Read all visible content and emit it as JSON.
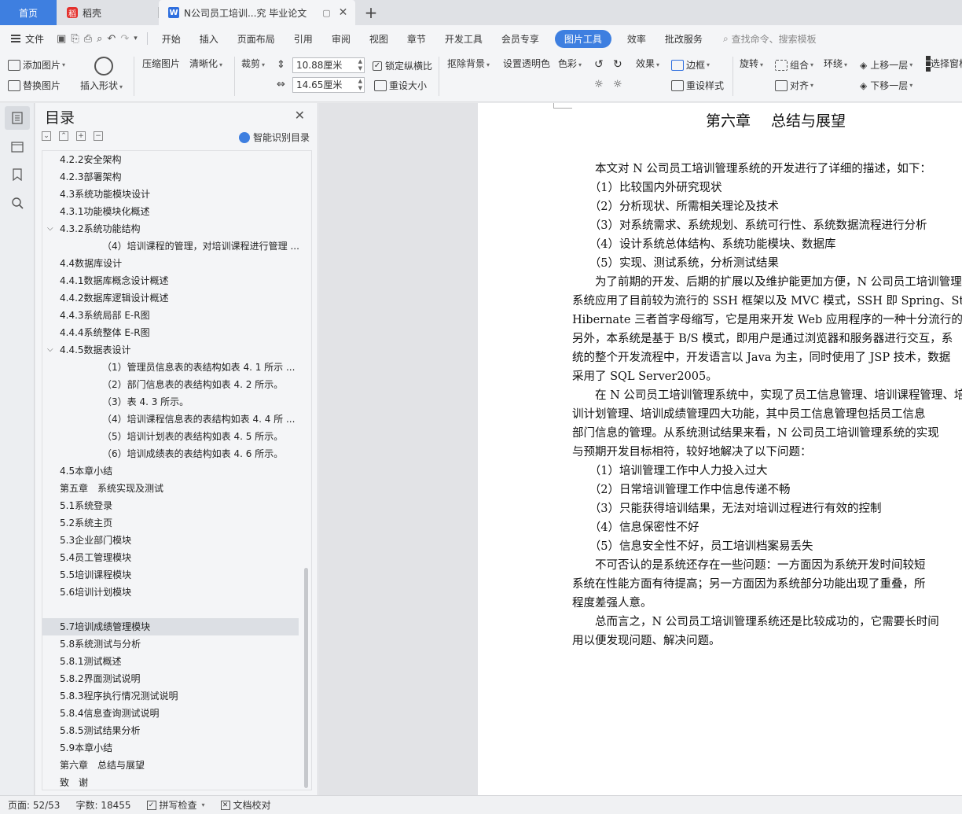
{
  "tabs": {
    "home": "首页",
    "dk": "稻壳",
    "doc": "N公司员工培训...究 毕业论文"
  },
  "menu": {
    "file": "文件",
    "items": [
      "开始",
      "插入",
      "页面布局",
      "引用",
      "审阅",
      "视图",
      "章节",
      "开发工具",
      "会员专享"
    ],
    "active": "图片工具",
    "after": [
      "效率",
      "批改服务"
    ],
    "search": "查找命令、搜索模板"
  },
  "ribbon": {
    "add_image": "添加图片",
    "replace_image": "替换图片",
    "insert_shape": "插入形状",
    "compress": "压缩图片",
    "sharpen": "清晰化",
    "crop": "裁剪",
    "height": "10.88厘米",
    "width": "14.65厘米",
    "lock_ratio": "锁定纵横比",
    "reset_size": "重设大小",
    "remove_bg": "抠除背景",
    "set_transparent": "设置透明色",
    "color": "色彩",
    "effects": "效果",
    "border": "边框",
    "reset_style": "重设样式",
    "rotate": "旋转",
    "group": "组合",
    "align": "对齐",
    "wrap": "环绕",
    "bring_forward": "上移一层",
    "send_backward": "下移一层",
    "select_pane": "选择窗格"
  },
  "toc": {
    "title": "目录",
    "smart": "智能识别目录",
    "items": [
      {
        "text": "4.2.2安全架构",
        "level": 1
      },
      {
        "text": "4.2.3部署架构",
        "level": 1
      },
      {
        "text": "4.3系统功能模块设计",
        "level": 1
      },
      {
        "text": "4.3.1功能模块化概述",
        "level": 1
      },
      {
        "text": "4.3.2系统功能结构",
        "level": 1,
        "expanded": true
      },
      {
        "text": "（4）培训课程的管理，对培训课程进行管理 ...",
        "level": 2
      },
      {
        "text": "4.4数据库设计",
        "level": 1
      },
      {
        "text": "4.4.1数据库概念设计概述",
        "level": 1
      },
      {
        "text": "4.4.2数据库逻辑设计概述",
        "level": 1
      },
      {
        "text": "4.4.3系统局部 E-R图",
        "level": 1
      },
      {
        "text": "4.4.4系统整体 E-R图",
        "level": 1
      },
      {
        "text": "4.4.5数据表设计",
        "level": 1,
        "expanded": true
      },
      {
        "text": "（1）管理员信息表的表结构如表 4. 1 所示 ...",
        "level": 2
      },
      {
        "text": "（2）部门信息表的表结构如表 4. 2 所示。",
        "level": 2
      },
      {
        "text": "（3）表 4. 3 所示。",
        "level": 2
      },
      {
        "text": "（4）培训课程信息表的表结构如表 4. 4 所 ...",
        "level": 2
      },
      {
        "text": "（5）培训计划表的表结构如表 4. 5 所示。",
        "level": 2
      },
      {
        "text": "（6）培训成绩表的表结构如表 4. 6 所示。",
        "level": 2
      },
      {
        "text": "4.5本章小结",
        "level": 1
      },
      {
        "text": "第五章　系统实现及测试",
        "level": 1
      },
      {
        "text": "5.1系统登录",
        "level": 1
      },
      {
        "text": "5.2系统主页",
        "level": 1
      },
      {
        "text": "5.3企业部门模块",
        "level": 1
      },
      {
        "text": "5.4员工管理模块",
        "level": 1
      },
      {
        "text": "5.5培训课程模块",
        "level": 1
      },
      {
        "text": "5.6培训计划模块",
        "level": 1
      },
      {
        "text": "",
        "level": 1
      },
      {
        "text": "5.7培训成绩管理模块",
        "level": 1,
        "selected": true
      },
      {
        "text": "5.8系统测试与分析",
        "level": 1
      },
      {
        "text": "5.8.1测试概述",
        "level": 1
      },
      {
        "text": "5.8.2界面测试说明",
        "level": 1
      },
      {
        "text": "5.8.3程序执行情况测试说明",
        "level": 1
      },
      {
        "text": "5.8.4信息查询测试说明",
        "level": 1
      },
      {
        "text": "5.8.5测试结果分析",
        "level": 1
      },
      {
        "text": "5.9本章小结",
        "level": 1
      },
      {
        "text": "第六章　总结与展望",
        "level": 1
      },
      {
        "text": "致　谢",
        "level": 1
      }
    ]
  },
  "document": {
    "chapter_no": "第六章",
    "chapter_title": "总结与展望",
    "lines": [
      "　　本文对 N 公司员工培训管理系统的开发进行了详细的描述，如下：",
      "　　（1）比较国内外研究现状",
      "　　（2）分析现状、所需相关理论及技术",
      "　　（3）对系统需求、系统规划、系统可行性、系统数据流程进行分析",
      "　　（4）设计系统总体结构、系统功能模块、数据库",
      "　　（5）实现、测试系统，分析测试结果",
      "　　为了前期的开发、后期的扩展以及维护能更加方便，N 公司员工培训管理",
      "系统应用了目前较为流行的 SSH 框架以及 MVC 模式，SSH 即 Spring、Struts",
      "Hibernate 三者首字母缩写，它是用来开发 Web 应用程序的一种十分流行的",
      "另外，本系统是基于 B/S 模式，即用户是通过浏览器和服务器进行交互，系",
      "统的整个开发流程中，开发语言以 Java 为主，同时使用了 JSP 技术，数据",
      "采用了 SQL Server2005。",
      "　　在 N 公司员工培训管理系统中，实现了员工信息管理、培训课程管理、培",
      "训计划管理、培训成绩管理四大功能，其中员工信息管理包括员工信息",
      "部门信息的管理。从系统测试结果来看，N 公司员工培训管理系统的实现",
      "与预期开发目标相符，较好地解决了以下问题：",
      "　　（1）培训管理工作中人力投入过大",
      "　　（2）日常培训管理工作中信息传递不畅",
      "　　（3）只能获得培训结果，无法对培训过程进行有效的控制",
      "　　（4）信息保密性不好",
      "　　（5）信息安全性不好，员工培训档案易丢失",
      "　　不可否认的是系统还存在一些问题：一方面因为系统开发时间较短",
      "系统在性能方面有待提高；另一方面因为系统部分功能出现了重叠，所",
      "程度差强人意。",
      "　　总而言之，N 公司员工培训管理系统还是比较成功的，它需要长时间",
      "用以便发现问题、解决问题。"
    ]
  },
  "status": {
    "page": "页面: 52/53",
    "words": "字数: 18455",
    "spell": "拼写检查",
    "proof": "文档校对"
  },
  "colors": {
    "accent": "#3e7fe0",
    "page": "#ffffff",
    "workspace": "#e2e3e6"
  }
}
